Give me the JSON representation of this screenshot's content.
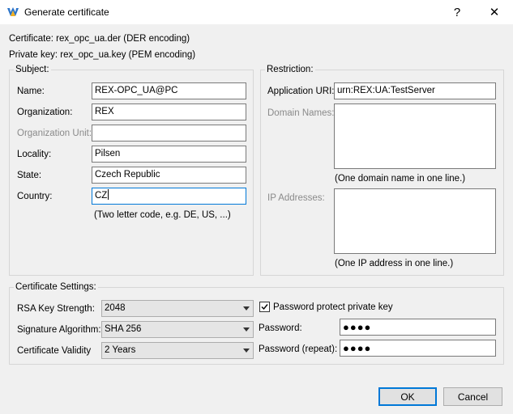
{
  "window": {
    "title": "Generate certificate",
    "help_glyph": "?",
    "close_glyph": "✕",
    "icon": "app-logo-icon"
  },
  "info": {
    "certificate": "Certificate: rex_opc_ua.der (DER encoding)",
    "private_key": "Private key: rex_opc_ua.key (PEM encoding)"
  },
  "subject": {
    "legend": "Subject:",
    "name_label": "Name:",
    "name_value": "REX-OPC_UA@PC",
    "organization_label": "Organization:",
    "organization_value": "REX",
    "org_unit_label": "Organization Unit:",
    "org_unit_value": "",
    "locality_label": "Locality:",
    "locality_value": "Pilsen",
    "state_label": "State:",
    "state_value": "Czech Republic",
    "country_label": "Country:",
    "country_value": "CZ",
    "country_hint": "(Two letter code, e.g. DE, US, ...)"
  },
  "restriction": {
    "legend": "Restriction:",
    "app_uri_label": "Application URI:",
    "app_uri_value": "urn:REX:UA:TestServer",
    "domain_label": "Domain Names:",
    "domain_hint": "(One domain name in one line.)",
    "ip_label": "IP Addresses:",
    "ip_hint": "(One IP address in one line.)"
  },
  "settings": {
    "legend": "Certificate Settings:",
    "rsa_label": "RSA Key Strength:",
    "rsa_value": "2048",
    "sig_label": "Signature Algorithm:",
    "sig_value": "SHA 256",
    "validity_label": "Certificate Validity",
    "validity_value": "2 Years",
    "protect_label": "Password protect private key",
    "protect_checked": true,
    "password_label": "Password:",
    "password_value": "●●●●",
    "password_repeat_label": "Password (repeat):",
    "password_repeat_value": "●●●●"
  },
  "buttons": {
    "ok": "OK",
    "cancel": "Cancel"
  },
  "colors": {
    "accent": "#0078d7",
    "disabled_text": "#8a8a8a",
    "window_bg": "#f0f0f0"
  }
}
